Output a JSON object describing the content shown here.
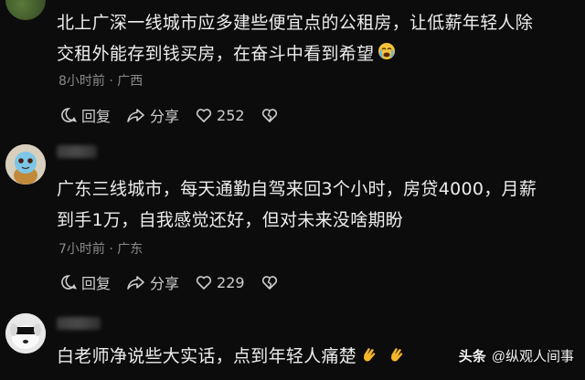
{
  "comments": [
    {
      "text_line1": "北上广深一线城市应多建些便宜点的公租房，让低薪年轻人除",
      "text_line2": "交租外能存到钱买房，在奋斗中看到希望",
      "meta": "8小时前 · 广西",
      "reply_label": "回复",
      "share_label": "分享",
      "like_count": "252",
      "emoji": "crying-face"
    },
    {
      "text_line1": "广东三线城市，每天通勤自驾来回3个小时，房贷4000，月薪",
      "text_line2": "到手1万，自我感觉还好，但对未来没啥期盼",
      "meta": "7小时前 · 广东",
      "reply_label": "回复",
      "share_label": "分享",
      "like_count": "229",
      "avatar": "squirtle-avatar"
    },
    {
      "text_line1": "白老师净说些大实话，点到年轻人痛楚",
      "avatar": "dog-avatar",
      "emoji": "clapping-hands"
    }
  ],
  "watermark": {
    "brand": "头条",
    "handle": "@纵观人间事"
  },
  "colors": {
    "background": "#0c0c0c",
    "text": "#ededed",
    "meta": "#8a8a8a"
  }
}
